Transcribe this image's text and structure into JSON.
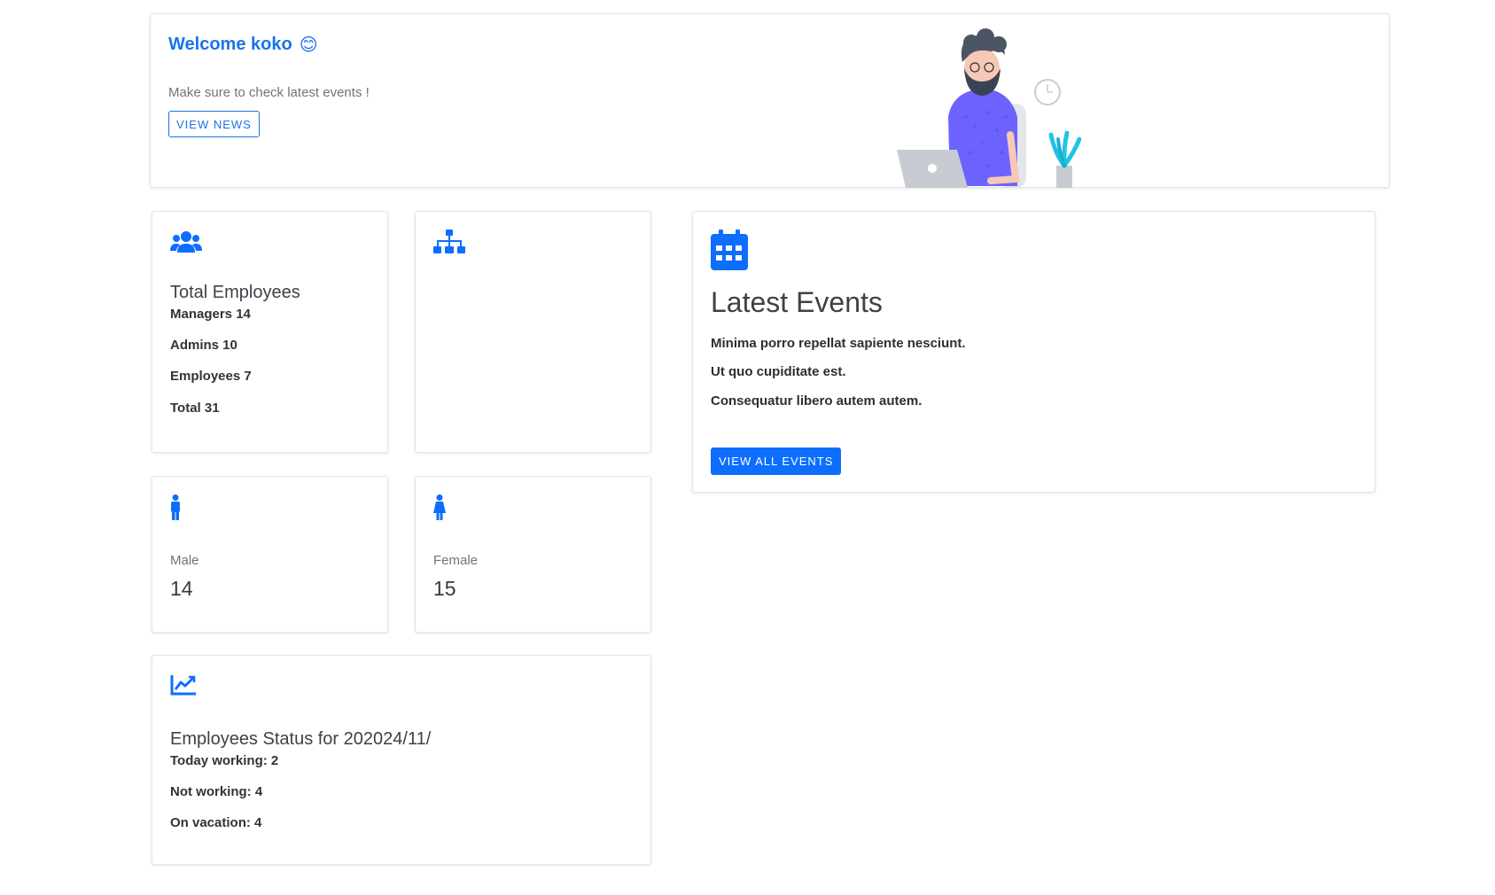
{
  "welcome": {
    "title": "Welcome koko",
    "emoji": "😊",
    "subtitle": "Make sure to check latest events !",
    "button_label": "VIEW NEWS"
  },
  "total_employees": {
    "icon": "users-icon",
    "heading": "Total Employees",
    "lines": [
      "Managers 14",
      "Admins 10",
      "Employees 7",
      "Total 31"
    ]
  },
  "org_card": {
    "icon": "sitemap-icon"
  },
  "male": {
    "icon": "male-icon",
    "label": "Male",
    "value": "14"
  },
  "female": {
    "icon": "female-icon",
    "label": "Female",
    "value": "15"
  },
  "status": {
    "icon": "chart-line-icon",
    "heading": "Employees Status for 202024/11/",
    "lines": [
      "Today working: 2",
      "Not working: 4",
      "On vacation: 4"
    ]
  },
  "events": {
    "icon": "calendar-icon",
    "heading": "Latest Events",
    "items": [
      "Minima porro repellat sapiente nesciunt.",
      "Ut quo cupiditate est.",
      "Consequatur libero autem autem."
    ],
    "button_label": "VIEW ALL EVENTS"
  },
  "colors": {
    "primary": "#0d6efd",
    "link": "#1a73e8",
    "muted": "#6c757d",
    "text": "#343a40"
  }
}
